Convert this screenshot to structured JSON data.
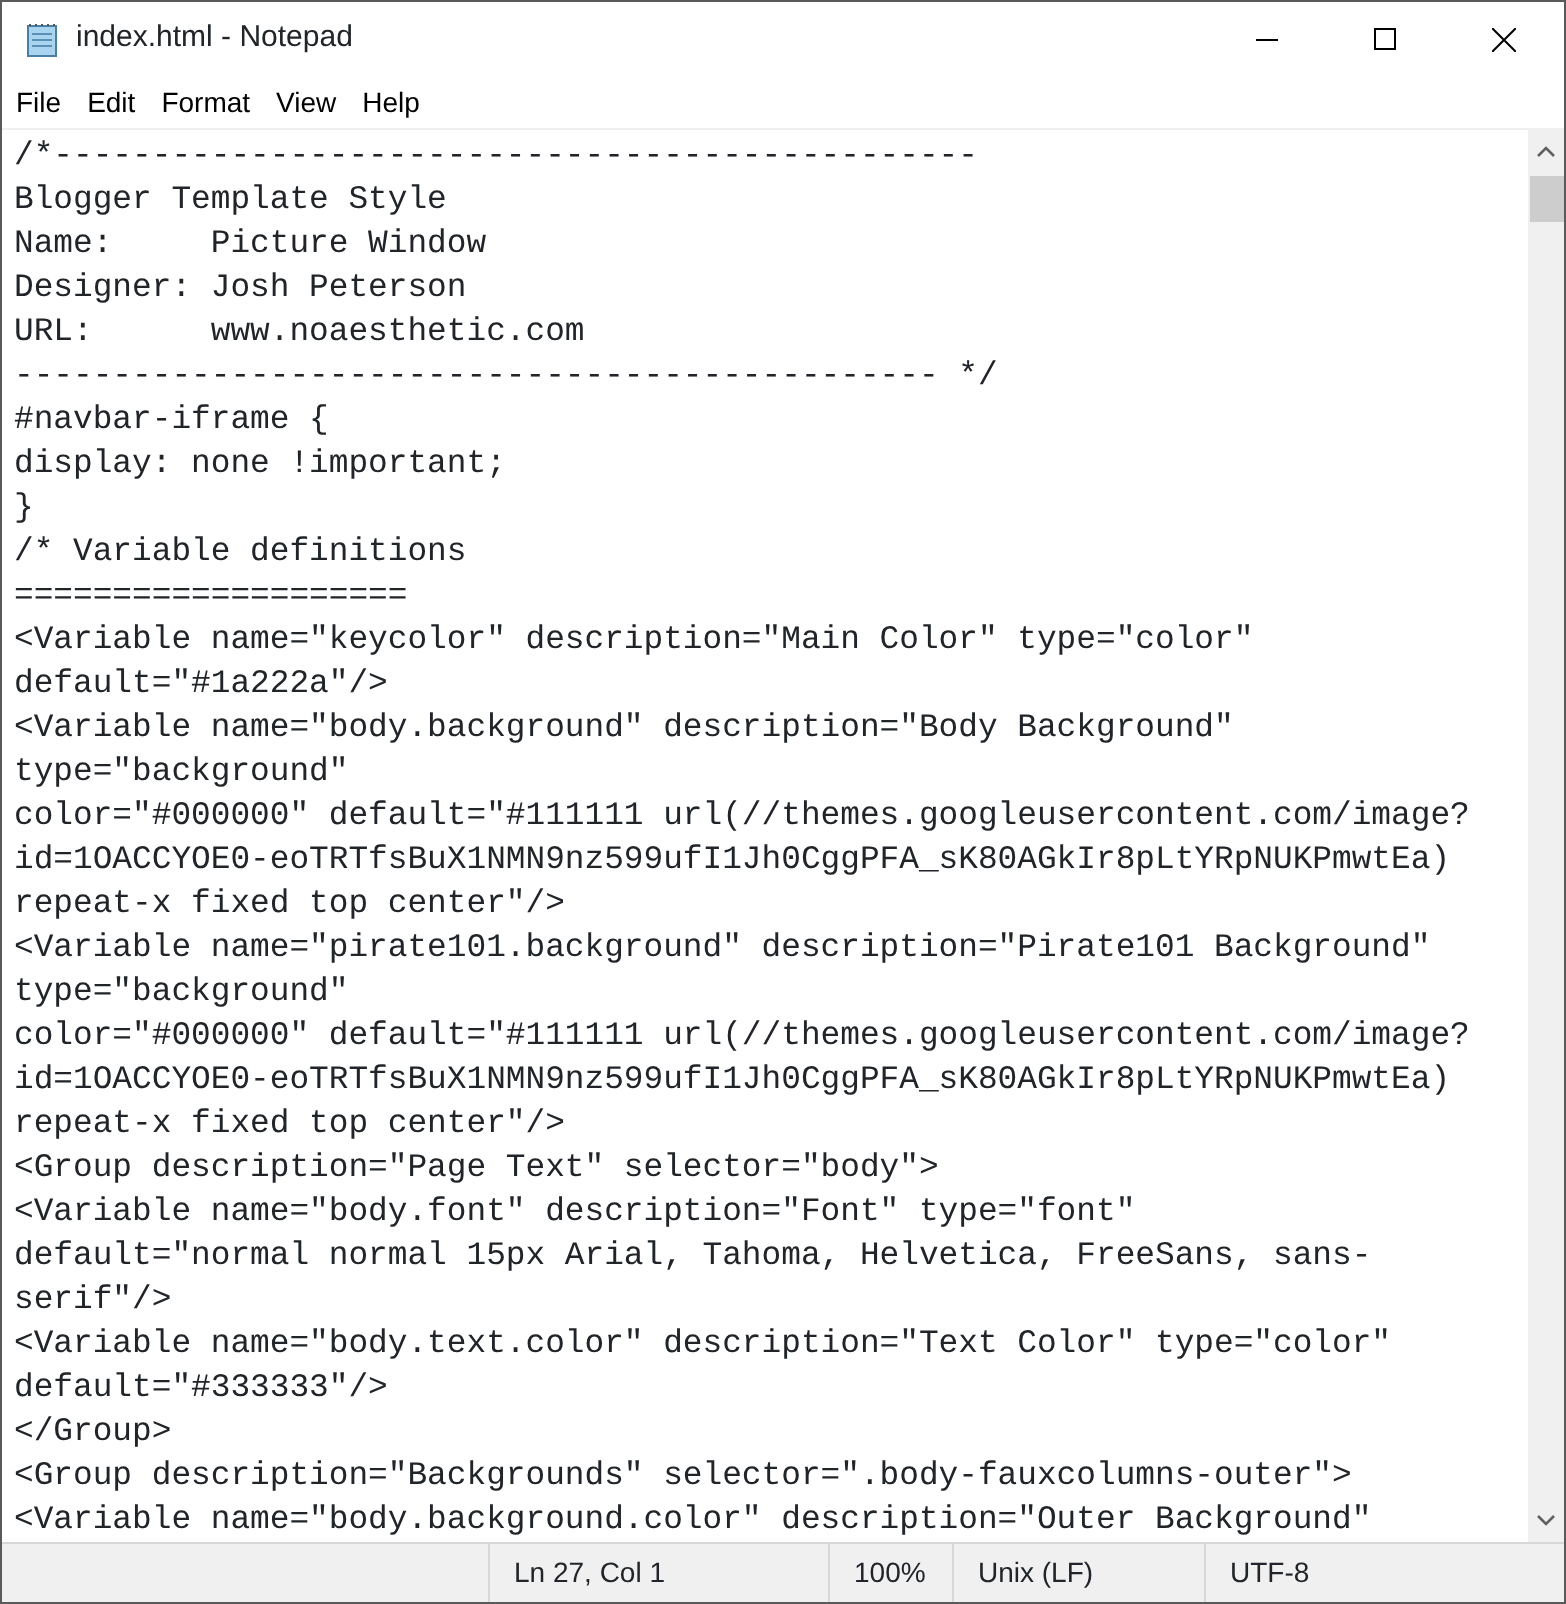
{
  "window": {
    "title": "index.html - Notepad"
  },
  "menu": [
    "File",
    "Edit",
    "Format",
    "View",
    "Help"
  ],
  "editor": {
    "lines": [
      "/*-----------------------------------------------",
      "Blogger Template Style",
      "Name:     Picture Window",
      "Designer: Josh Peterson",
      "URL:      www.noaesthetic.com",
      "----------------------------------------------- */",
      "#navbar-iframe {",
      "display: none !important;",
      "}",
      "/* Variable definitions",
      "====================",
      "<Variable name=\"keycolor\" description=\"Main Color\" type=\"color\"",
      "default=\"#1a222a\"/>",
      "<Variable name=\"body.background\" description=\"Body Background\"",
      "type=\"background\"",
      "color=\"#000000\" default=\"#111111 url(//themes.googleusercontent.com/image?",
      "id=1OACCYOE0-eoTRTfsBuX1NMN9nz599ufI1Jh0CggPFA_sK80AGkIr8pLtYRpNUKPmwtEa)",
      "repeat-x fixed top center\"/>",
      "<Variable name=\"pirate101.background\" description=\"Pirate101 Background\"",
      "type=\"background\"",
      "color=\"#000000\" default=\"#111111 url(//themes.googleusercontent.com/image?",
      "id=1OACCYOE0-eoTRTfsBuX1NMN9nz599ufI1Jh0CggPFA_sK80AGkIr8pLtYRpNUKPmwtEa)",
      "repeat-x fixed top center\"/>",
      "<Group description=\"Page Text\" selector=\"body\">",
      "<Variable name=\"body.font\" description=\"Font\" type=\"font\"",
      "default=\"normal normal 15px Arial, Tahoma, Helvetica, FreeSans, sans-",
      "serif\"/>",
      "<Variable name=\"body.text.color\" description=\"Text Color\" type=\"color\"",
      "default=\"#333333\"/>",
      "</Group>",
      "<Group description=\"Backgrounds\" selector=\".body-fauxcolumns-outer\">",
      "<Variable name=\"body.background.color\" description=\"Outer Background\""
    ]
  },
  "status_bar": [
    "Ln 27, Col 1",
    "100%",
    "Unix (LF)",
    "UTF-8"
  ]
}
